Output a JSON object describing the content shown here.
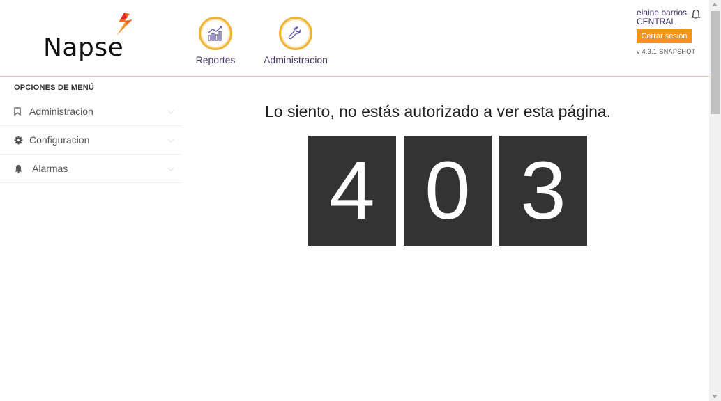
{
  "header": {
    "logo_text": "Napse",
    "nav": [
      {
        "label": "Reportes",
        "icon": "chart-icon"
      },
      {
        "label": "Administracion",
        "icon": "wrench-icon"
      }
    ],
    "user": {
      "name": "elaine barrios",
      "org": "CENTRAL",
      "logout_label": "Cerrar sesión",
      "version": "v 4.3.1-SNAPSHOT"
    }
  },
  "sidebar": {
    "title": "OPCIONES DE MENÚ",
    "items": [
      {
        "label": "Administracion",
        "icon": "bookmark-icon"
      },
      {
        "label": "Configuracion",
        "icon": "gear-icon"
      },
      {
        "label": "Alarmas",
        "icon": "bell-icon"
      }
    ]
  },
  "main": {
    "message": "Lo siento, no estás autorizado a ver esta página.",
    "digits": [
      "4",
      "0",
      "3"
    ]
  },
  "colors": {
    "accent": "#f7941d",
    "gold": "#f2b233",
    "purple": "#3a2a66",
    "digit_bg": "#333333"
  }
}
